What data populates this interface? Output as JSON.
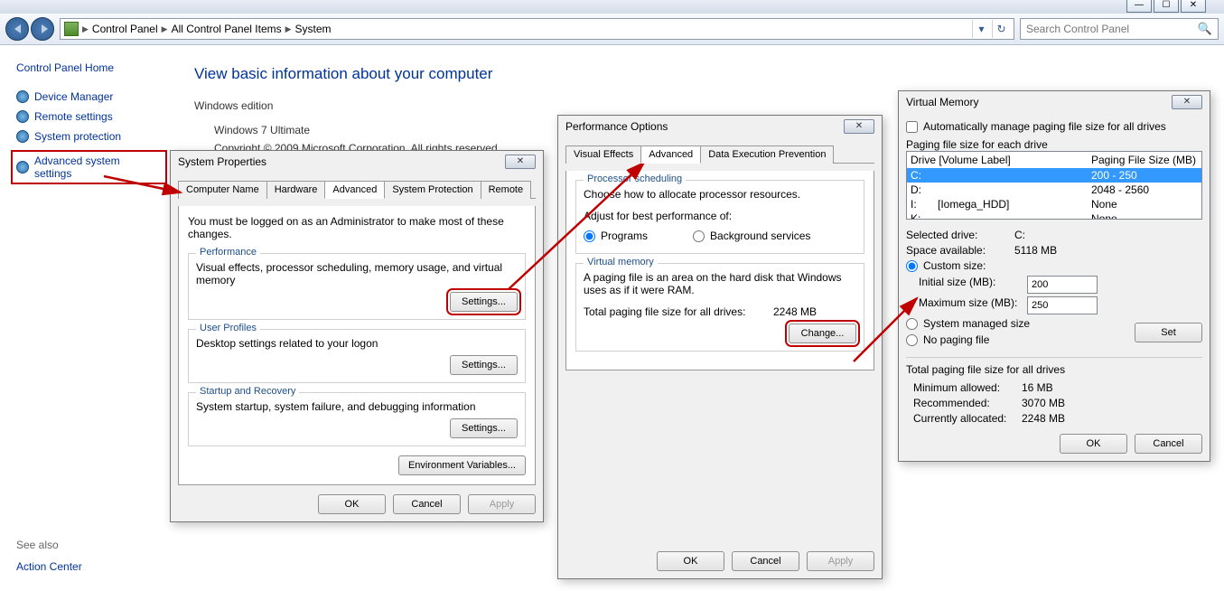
{
  "titlebar": {
    "min": "—",
    "max": "☐",
    "close": "✕"
  },
  "breadcrumb": {
    "cp": "Control Panel",
    "all": "All Control Panel Items",
    "sys": "System"
  },
  "search": {
    "placeholder": "Search Control Panel"
  },
  "sidebar": {
    "home": "Control Panel Home",
    "items": [
      "Device Manager",
      "Remote settings",
      "System protection",
      "Advanced system settings"
    ]
  },
  "content": {
    "heading": "View basic information about your computer",
    "edition_label": "Windows edition",
    "edition_name": "Windows 7 Ultimate",
    "copyright": "Copyright © 2009 Microsoft Corporation.  All rights reserved."
  },
  "seealso": {
    "label": "See also",
    "ac": "Action Center"
  },
  "sysprops": {
    "title": "System Properties",
    "tabs": [
      "Computer Name",
      "Hardware",
      "Advanced",
      "System Protection",
      "Remote"
    ],
    "note": "You must be logged on as an Administrator to make most of these changes.",
    "perf": {
      "legend": "Performance",
      "desc": "Visual effects, processor scheduling, memory usage, and virtual memory",
      "btn": "Settings..."
    },
    "prof": {
      "legend": "User Profiles",
      "desc": "Desktop settings related to your logon",
      "btn": "Settings..."
    },
    "startup": {
      "legend": "Startup and Recovery",
      "desc": "System startup, system failure, and debugging information",
      "btn": "Settings..."
    },
    "env": "Environment Variables...",
    "ok": "OK",
    "cancel": "Cancel",
    "apply": "Apply"
  },
  "perfopt": {
    "title": "Performance Options",
    "tabs": [
      "Visual Effects",
      "Advanced",
      "Data Execution Prevention"
    ],
    "sched": {
      "legend": "Processor scheduling",
      "desc": "Choose how to allocate processor resources.",
      "adjust": "Adjust for best performance of:",
      "programs": "Programs",
      "bg": "Background services"
    },
    "vmem": {
      "legend": "Virtual memory",
      "desc": "A paging file is an area on the hard disk that Windows uses as if it were RAM.",
      "totlabel": "Total paging file size for all drives:",
      "totval": "2248 MB",
      "change": "Change..."
    },
    "ok": "OK",
    "cancel": "Cancel",
    "apply": "Apply"
  },
  "vmem": {
    "title": "Virtual Memory",
    "auto": "Automatically manage paging file size for all drives",
    "listlabel": "Paging file size for each drive",
    "hdr_drive": "Drive  [Volume Label]",
    "hdr_size": "Paging File Size (MB)",
    "rows": [
      {
        "d": "C:",
        "vol": "",
        "size": "200 - 250",
        "sel": true
      },
      {
        "d": "D:",
        "vol": "",
        "size": "2048 - 2560"
      },
      {
        "d": "I:",
        "vol": "[Iomega_HDD]",
        "size": "None"
      },
      {
        "d": "K:",
        "vol": "",
        "size": "None"
      }
    ],
    "seldrive_l": "Selected drive:",
    "seldrive_v": "C:",
    "space_l": "Space available:",
    "space_v": "5118 MB",
    "custom": "Custom size:",
    "init_l": "Initial size (MB):",
    "init_v": "200",
    "max_l": "Maximum size (MB):",
    "max_v": "250",
    "sysmgd": "System managed size",
    "nopf": "No paging file",
    "set": "Set",
    "totlabel": "Total paging file size for all drives",
    "min_l": "Minimum allowed:",
    "min_v": "16 MB",
    "rec_l": "Recommended:",
    "rec_v": "3070 MB",
    "cur_l": "Currently allocated:",
    "cur_v": "2248 MB",
    "ok": "OK",
    "cancel": "Cancel"
  }
}
